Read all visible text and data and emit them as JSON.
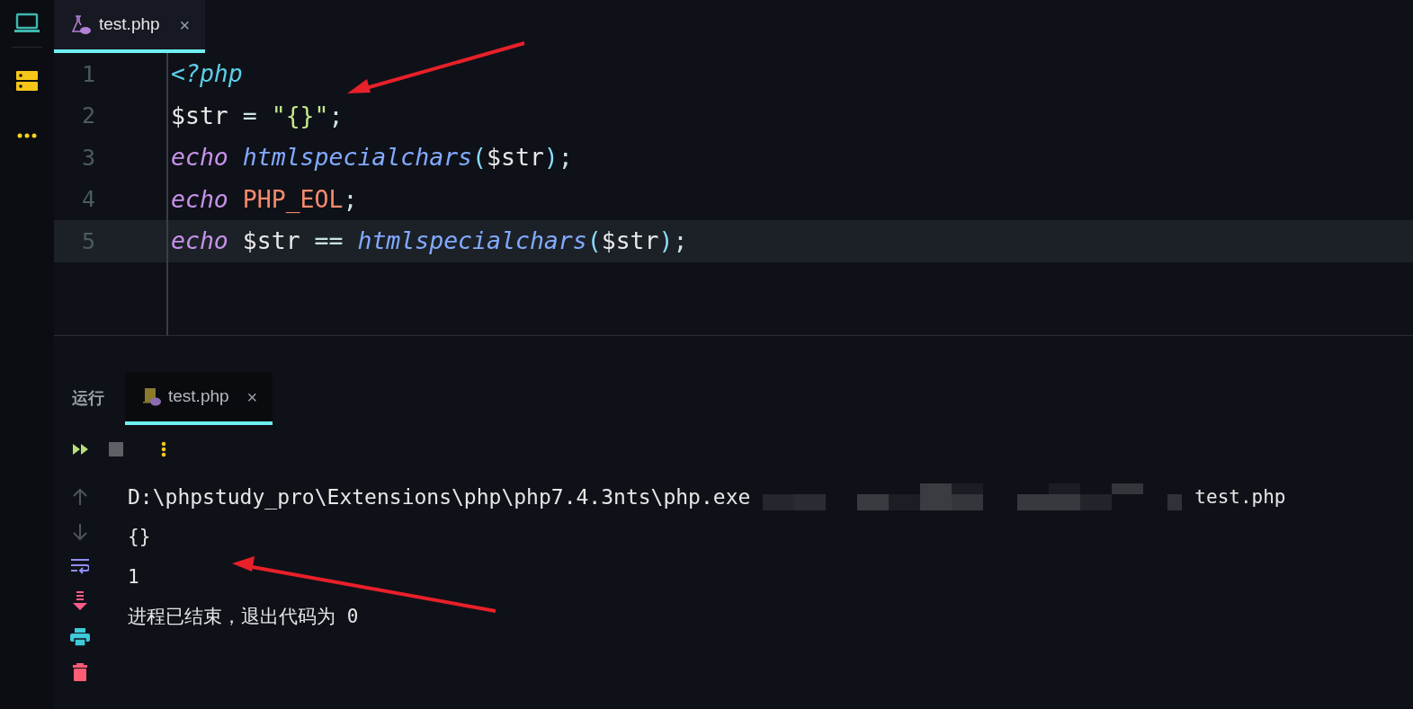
{
  "editor_tab": {
    "label": "test.php",
    "close": "×",
    "selected": true
  },
  "code_lines": [
    {
      "number": "1",
      "current": false,
      "tokens": [
        {
          "kind": "tag",
          "text": "<?php"
        }
      ]
    },
    {
      "number": "2",
      "current": false,
      "tokens": [
        {
          "kind": "variable",
          "text": "$str"
        },
        {
          "kind": "punct",
          "text": " = "
        },
        {
          "kind": "string",
          "text": "\"{}\""
        },
        {
          "kind": "punct",
          "text": ";"
        }
      ]
    },
    {
      "number": "3",
      "current": false,
      "tokens": [
        {
          "kind": "keyword",
          "text": "echo"
        },
        {
          "kind": "function",
          "text": "htmlspecialchars"
        },
        {
          "kind": "paren",
          "text": "("
        },
        {
          "kind": "variable",
          "text": "$str"
        },
        {
          "kind": "paren",
          "text": ")"
        },
        {
          "kind": "punct",
          "text": ";"
        }
      ]
    },
    {
      "number": "4",
      "current": false,
      "tokens": [
        {
          "kind": "keyword",
          "text": "echo"
        },
        {
          "kind": "constant",
          "text": "PHP_EOL"
        },
        {
          "kind": "punct",
          "text": ";"
        }
      ]
    },
    {
      "number": "5",
      "current": true,
      "tokens": [
        {
          "kind": "keyword",
          "text": "echo"
        },
        {
          "kind": "variable",
          "text": "$str"
        },
        {
          "kind": "punct",
          "text": " == "
        },
        {
          "kind": "function",
          "text": "htmlspecialchars"
        },
        {
          "kind": "paren",
          "text": "("
        },
        {
          "kind": "variable",
          "text": "$str"
        },
        {
          "kind": "paren",
          "text": ")"
        },
        {
          "kind": "punct",
          "text": ";"
        }
      ]
    }
  ],
  "run_panel": {
    "title": "运行",
    "tab": {
      "label": "test.php",
      "close": "×",
      "selected": true
    },
    "output": [
      {
        "kind": "command",
        "text": "D:\\phpstudy_pro\\Extensions\\php\\php7.4.3nts\\php.exe",
        "tail": "test.php"
      },
      {
        "kind": "plain",
        "text": "{}"
      },
      {
        "kind": "plain",
        "text": "1"
      },
      {
        "kind": "plain",
        "text": "进程已结束，退出代码为 0"
      }
    ]
  }
}
